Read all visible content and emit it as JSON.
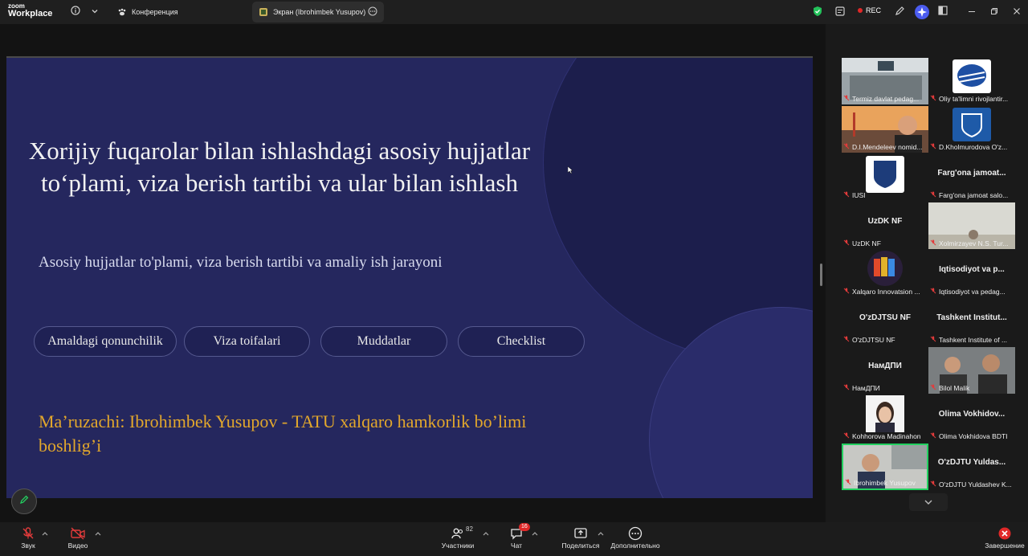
{
  "app": {
    "logo_line1": "zoom",
    "logo_line2": "Workplace"
  },
  "tabs": [
    {
      "label": "Конференция"
    },
    {
      "label": "Экран (Ibrohimbek Yusupov)"
    }
  ],
  "toolbar": {
    "rec_label": "REC"
  },
  "slide": {
    "title": "Xorijiy fuqarolar bilan ishlashdagi asosiy hujjatlar  to‘plami, viza berish tartibi va ular bilan ishlash",
    "subtitle": "Asosiy hujjatlar to'plami, viza berish tartibi va amaliy ish jarayoni",
    "buttons": [
      "Amaldagi qonunchilik",
      "Viza toifalari",
      "Muddatlar",
      "Checklist"
    ],
    "speaker": "Ma’ruzachi:   Ibrohimbek Yusupov - TATU xalqaro hamkorlik bo’limi boshlig’i"
  },
  "gallery": [
    {
      "name": "Termiz davlat pedag...",
      "center": "",
      "kind": "classroom"
    },
    {
      "name": "Oliy ta'limni rivojlantir...",
      "center": "",
      "kind": "logo-blue"
    },
    {
      "name": "D.I.Mendeleev nomid...",
      "center": "",
      "kind": "person-bridge"
    },
    {
      "name": "D.Kholmurodova O'z...",
      "center": "",
      "kind": "logo-shield"
    },
    {
      "name": "IUSI",
      "center": "",
      "kind": "logo-iusi"
    },
    {
      "name": "Farg'ona jamoat salo...",
      "center": "Farg'ona  jamoat...",
      "kind": "text"
    },
    {
      "name": "UzDK NF",
      "center": "UzDK NF",
      "kind": "text"
    },
    {
      "name": "Xolmirzayev N.S. Tur...",
      "center": "",
      "kind": "room"
    },
    {
      "name": "Xalqaro Innovatsion ...",
      "center": "",
      "kind": "logo-book"
    },
    {
      "name": "Iqtisodiyot va pedag...",
      "center": "Iqtisodiyot  va  p...",
      "kind": "text"
    },
    {
      "name": "O'zDJTSU NF",
      "center": "O'zDJTSU NF",
      "kind": "text"
    },
    {
      "name": "Tashkent Institute of ...",
      "center": "Tashkent  Institut...",
      "kind": "text"
    },
    {
      "name": "НамДПИ",
      "center": "НамДПИ",
      "kind": "text"
    },
    {
      "name": "Bilol Malik",
      "center": "",
      "kind": "people"
    },
    {
      "name": "Kohhorova Madinahon",
      "center": "",
      "kind": "woman"
    },
    {
      "name": "Olima Vokhidova BDTI",
      "center": "Olima  Vokhidov...",
      "kind": "text"
    },
    {
      "name": "Ibrohimbek Yusupov",
      "center": "",
      "kind": "man",
      "speaking": true
    },
    {
      "name": "O'zDJTU Yuldashev K...",
      "center": "O'zDJTU  Yuldas...",
      "kind": "text"
    }
  ],
  "bottom": {
    "mic_label": "Звук",
    "video_label": "Видео",
    "participants_label": "Участники",
    "participants_count": "82",
    "chat_label": "Чат",
    "chat_badge": "16",
    "share_label": "Поделиться",
    "more_label": "Дополнительно",
    "end_label": "Завершение"
  },
  "colors": {
    "slide_bg": "#25275e",
    "speaker_text": "#e2a72c",
    "speaking_border": "#23d160",
    "muted_red": "#e23b3b"
  }
}
